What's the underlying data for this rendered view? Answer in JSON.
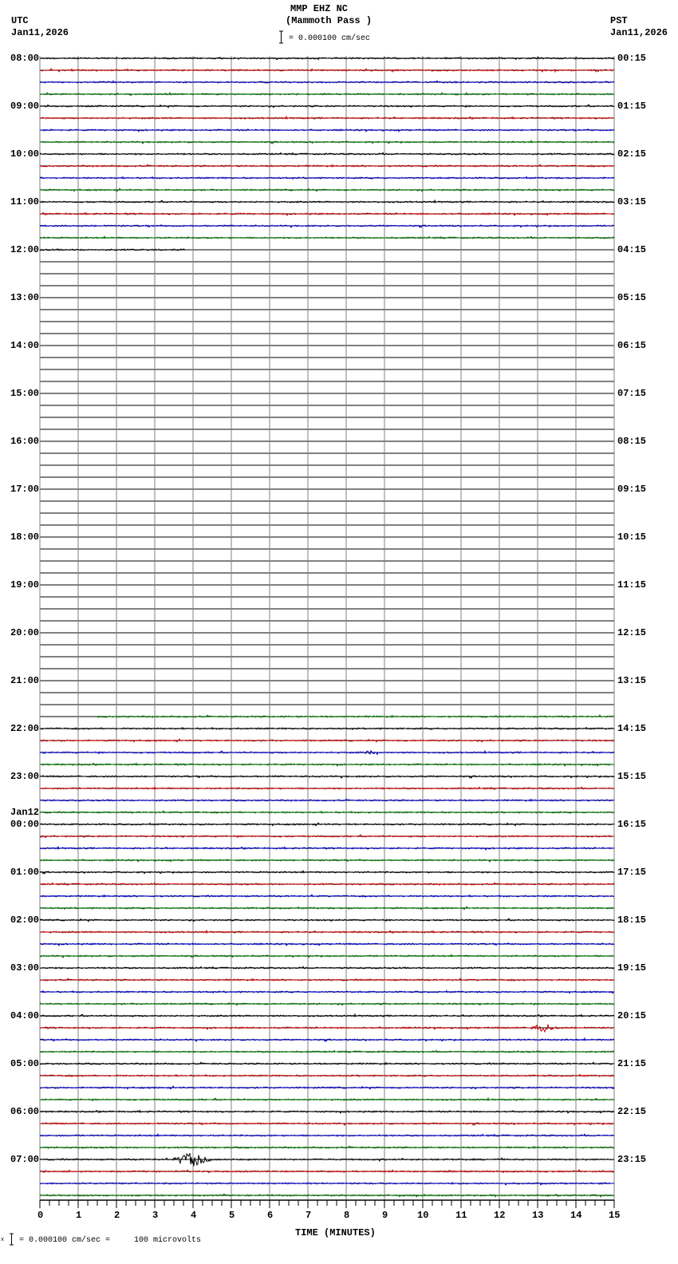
{
  "header": {
    "station": "MMP EHZ NC",
    "location": "(Mammoth Pass )",
    "left_zone": "UTC",
    "left_date": "Jan11,2026",
    "right_zone": "PST",
    "right_date": "Jan11,2026",
    "scale_text": "= 0.000100 cm/sec"
  },
  "footer": {
    "scale_note": "= 0.000100 cm/sec =     100 microvolts",
    "scale_prefix": "x"
  },
  "colors": {
    "trace_cycle": [
      "#000000",
      "#cc0000",
      "#0000cc",
      "#007700"
    ],
    "grid": "#808080"
  },
  "chart_data": {
    "type": "line",
    "subtype": "helicorder",
    "xlabel": "TIME (MINUTES)",
    "xlim": [
      0,
      15
    ],
    "x_ticks": [
      "0",
      "1",
      "2",
      "3",
      "4",
      "5",
      "6",
      "7",
      "8",
      "9",
      "10",
      "11",
      "12",
      "13",
      "14",
      "15"
    ],
    "rows_total": 96,
    "row_minutes": 15,
    "left_labels": [
      {
        "row": 0,
        "text": "08:00"
      },
      {
        "row": 4,
        "text": "09:00"
      },
      {
        "row": 8,
        "text": "10:00"
      },
      {
        "row": 12,
        "text": "11:00"
      },
      {
        "row": 16,
        "text": "12:00"
      },
      {
        "row": 20,
        "text": "13:00"
      },
      {
        "row": 24,
        "text": "14:00"
      },
      {
        "row": 28,
        "text": "15:00"
      },
      {
        "row": 32,
        "text": "16:00"
      },
      {
        "row": 36,
        "text": "17:00"
      },
      {
        "row": 40,
        "text": "18:00"
      },
      {
        "row": 44,
        "text": "19:00"
      },
      {
        "row": 48,
        "text": "20:00"
      },
      {
        "row": 52,
        "text": "21:00"
      },
      {
        "row": 56,
        "text": "22:00"
      },
      {
        "row": 60,
        "text": "23:00"
      },
      {
        "row": 64,
        "text": "00:00",
        "date": "Jan12"
      },
      {
        "row": 68,
        "text": "01:00"
      },
      {
        "row": 72,
        "text": "02:00"
      },
      {
        "row": 76,
        "text": "03:00"
      },
      {
        "row": 80,
        "text": "04:00"
      },
      {
        "row": 84,
        "text": "05:00"
      },
      {
        "row": 88,
        "text": "06:00"
      },
      {
        "row": 92,
        "text": "07:00"
      }
    ],
    "right_labels": [
      "00:15",
      "01:15",
      "02:15",
      "03:15",
      "04:15",
      "05:15",
      "06:15",
      "07:15",
      "08:15",
      "09:15",
      "10:15",
      "11:15",
      "12:15",
      "13:15",
      "14:15",
      "15:15",
      "16:15",
      "17:15",
      "18:15",
      "19:15",
      "20:15",
      "21:15",
      "22:15",
      "23:15"
    ],
    "data_segments": [
      {
        "rows": [
          0,
          15
        ],
        "start_min": 0,
        "end_min": 15
      },
      {
        "rows": [
          16,
          16
        ],
        "start_min": 0,
        "end_min": 3.8
      },
      {
        "rows": [
          55,
          55
        ],
        "start_min": 1.5,
        "end_min": 15
      },
      {
        "rows": [
          56,
          95
        ],
        "start_min": 0,
        "end_min": 15
      }
    ],
    "events": [
      {
        "row": 92,
        "start_min": 3.5,
        "end_min": 4.6,
        "amplitude": 9
      },
      {
        "row": 81,
        "start_min": 12.8,
        "end_min": 13.6,
        "amplitude": 5
      },
      {
        "row": 58,
        "start_min": 8.4,
        "end_min": 8.9,
        "amplitude": 3
      }
    ]
  }
}
